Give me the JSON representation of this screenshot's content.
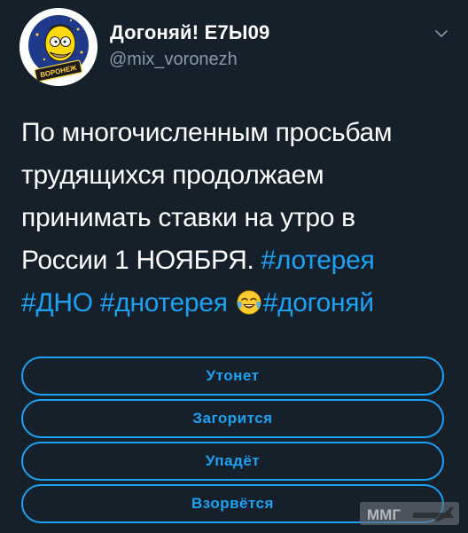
{
  "user": {
    "display_name": "Догоняй! Е7Ы09",
    "handle": "@mix_voronezh",
    "avatar_badge": "ВОРОНЕЖ"
  },
  "tweet": {
    "line1": "По многочисленным просьбам",
    "line2": "трудящихся продолжаем",
    "line3": "принимать ставки на утро в",
    "line4_text": "России 1 НОЯБРЯ.",
    "hashtag_lottery": "#лотерея",
    "hashtag_dno": "#ДНО",
    "hashtag_dnoterea": "#днотерея",
    "emoji": "face-with-tears-of-joy",
    "hashtag_dogonyay": "#догоняй"
  },
  "poll": {
    "options": [
      "Утонет",
      "Загорится",
      "Упадёт",
      "Взорвётся"
    ]
  },
  "watermark": {
    "text": "ММГ"
  },
  "colors": {
    "background": "#15202b",
    "accent": "#1da1f2",
    "secondary_text": "#8899a6"
  }
}
